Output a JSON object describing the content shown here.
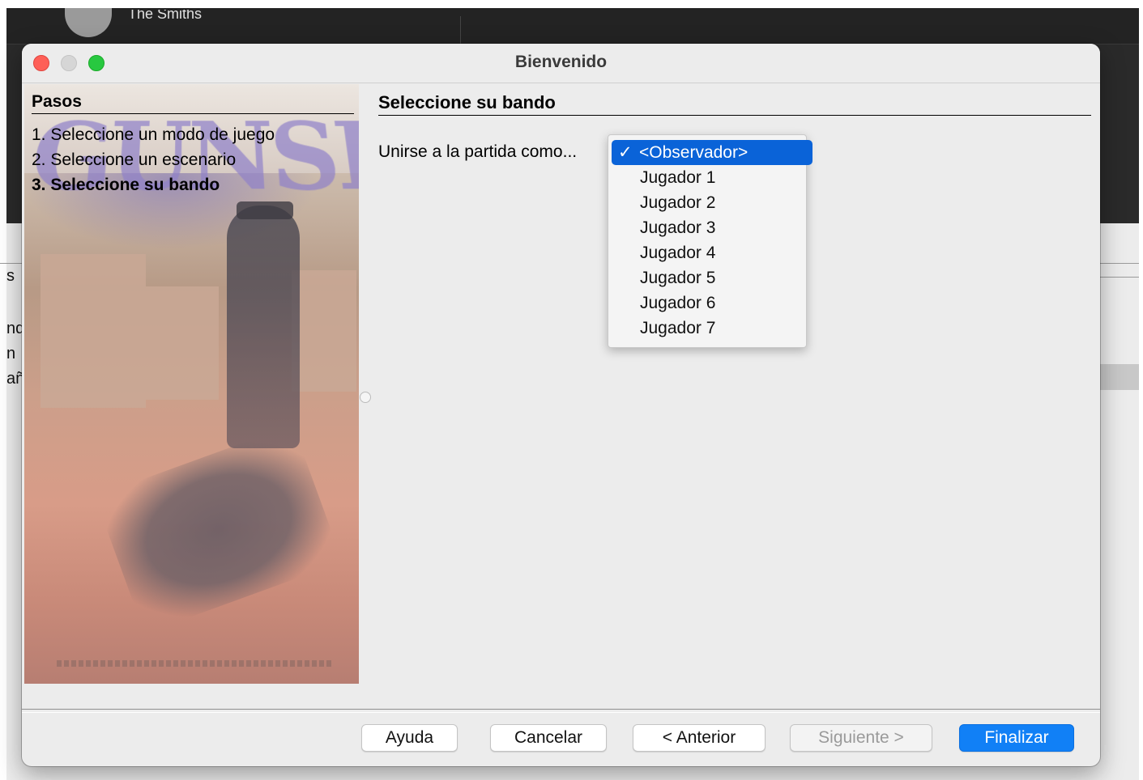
{
  "background_app": {
    "artist": "The Smiths",
    "fragments": [
      "s",
      "nd",
      "n",
      "añ"
    ]
  },
  "window": {
    "title": "Bienvenido"
  },
  "steps": {
    "title": "Pasos",
    "items": [
      {
        "label": "1. Seleccione un modo de juego",
        "active": false
      },
      {
        "label": "2. Seleccione un escenario",
        "active": false
      },
      {
        "label": "3. Seleccione su bando",
        "active": true
      }
    ],
    "poster_title": "GUNSLINGER"
  },
  "content": {
    "title": "Seleccione su bando",
    "join_label": "Unirse a la partida como...",
    "selected": "<Observador>",
    "check": "✓",
    "options": [
      "<Observador>",
      "Jugador 1",
      "Jugador 2",
      "Jugador 3",
      "Jugador 4",
      "Jugador 5",
      "Jugador 6",
      "Jugador 7"
    ]
  },
  "buttons": {
    "help": "Ayuda",
    "cancel": "Cancelar",
    "previous": "< Anterior",
    "next": "Siguiente >",
    "finish": "Finalizar"
  },
  "colors": {
    "accent": "#1180f6",
    "selection": "#0a63d8",
    "close": "#fe5f57",
    "maximize": "#28c840"
  }
}
